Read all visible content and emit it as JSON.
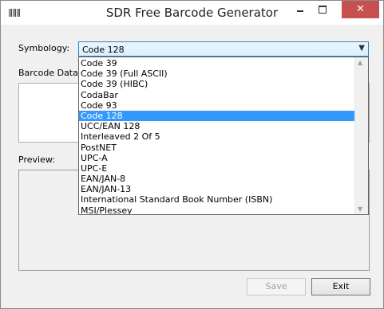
{
  "window": {
    "title": "SDR Free Barcode Generator",
    "close_glyph": "✕"
  },
  "form": {
    "symbology_label": "Symbology:",
    "selected_symbology": "Code 128",
    "barcode_data_label": "Barcode Data:",
    "barcode_data_value": "",
    "preview_label": "Preview:"
  },
  "dropdown": {
    "items": [
      "Code 39",
      "Code 39 (Full ASCII)",
      "Code 39 (HIBC)",
      "CodaBar",
      "Code 93",
      "Code 128",
      "UCC/EAN 128",
      "Interleaved 2 Of 5",
      "PostNET",
      "UPC-A",
      "UPC-E",
      "EAN/JAN-8",
      "EAN/JAN-13",
      "International Standard Book Number (ISBN)",
      "MSI/Plessey"
    ],
    "selected_index": 5
  },
  "buttons": {
    "save_label": "Save",
    "exit_label": "Exit"
  },
  "icons": {
    "app": "barcode-icon",
    "minimize": "minimize-icon",
    "maximize": "maximize-icon",
    "close": "close-icon",
    "combo_arrow": "chevron-down-icon"
  },
  "colors": {
    "selection": "#3399ff",
    "close_button": "#c75050"
  }
}
